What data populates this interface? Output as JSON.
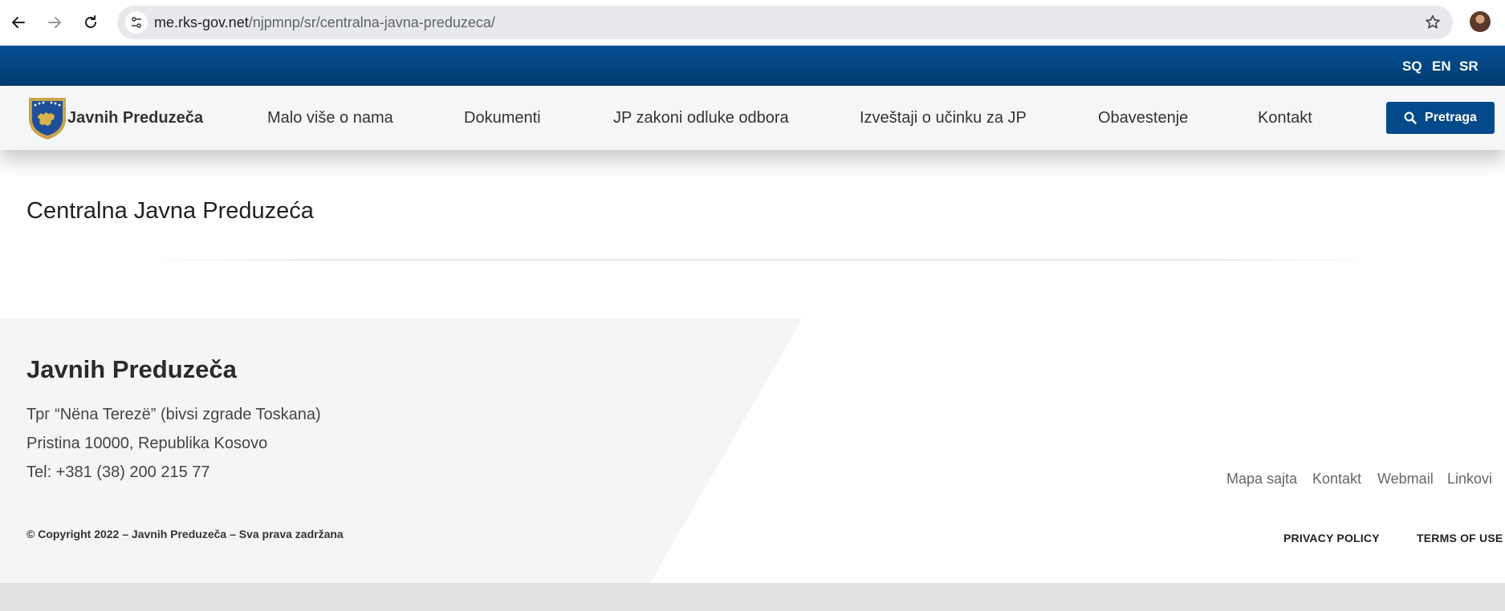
{
  "browser": {
    "url_host": "me.rks-gov.net",
    "url_path": "/njpmnp/sr/centralna-javna-preduzeca/"
  },
  "languages": [
    "SQ",
    "EN",
    "SR"
  ],
  "header": {
    "brand": "Javnih Preduzeča",
    "menu": [
      "Malo više o nama",
      "Dokumenti",
      "JP zakoni odluke odbora",
      "Izveštaji o učinku za JP",
      "Obavestenje",
      "Kontakt"
    ],
    "search_label": "Pretraga"
  },
  "content": {
    "title": "Centralna Javna Preduzeća"
  },
  "footer": {
    "title": "Javnih Preduzeča",
    "address_line1": "Трг “Nëna Terezë” (bivsi zgrade Toskana)",
    "address_line2": "Pristina 10000, Republika Kosovo",
    "phone": "Tel: +381 (38) 200 215 77",
    "copyright": "© Copyright 2022 – Javnih Preduzeča – Sva prava zadržana",
    "links": [
      "Mapa sajta",
      "Kontakt",
      "Webmail",
      "Linkovi"
    ],
    "privacy": "PRIVACY POLICY",
    "terms": "TERMS OF USE"
  },
  "colors": {
    "brand_blue": "#054a8a",
    "footer_bg": "#f5f5f7"
  }
}
